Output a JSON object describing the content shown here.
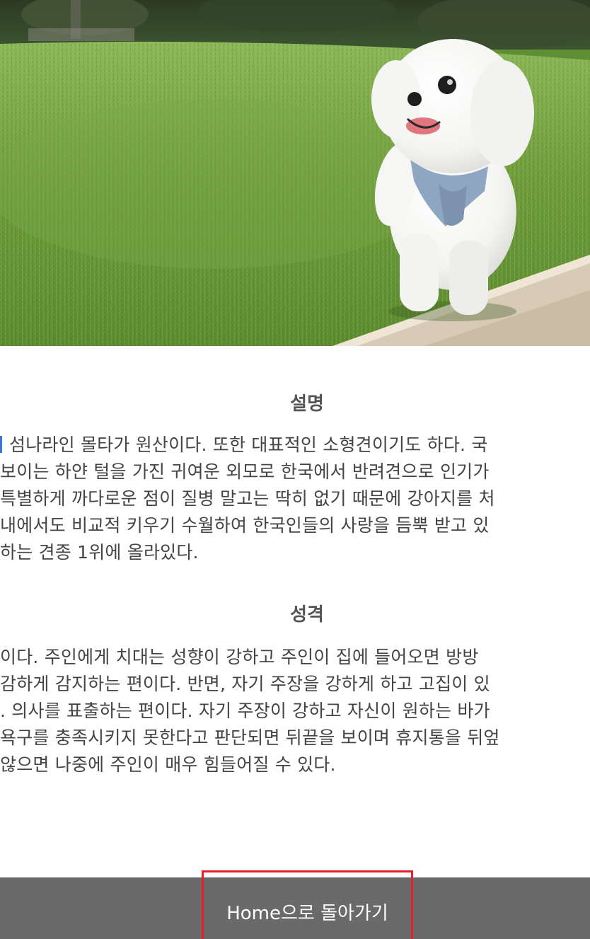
{
  "hero": {
    "image_alt": "흰색 몰티즈 강아지가 잔디밭 연석 위에 서 있는 사진",
    "icon": "photo"
  },
  "description": {
    "title": "설명",
    "lines": [
      "섬나라인 몰타가 원산이다. 또한 대표적인 소형견이기도 하다. 국",
      "보이는 하얀 털을 가진 귀여운 외모로 한국에서 반려견으로 인기가",
      "특별하게 까다로운 점이 질병 말고는 딱히 없기 때문에 강아지를 처",
      "내에서도 비교적 키우기 수월하여 한국인들의 사랑을 듬뿍 받고 있",
      "하는 견종 1위에 올라있다."
    ]
  },
  "personality": {
    "title": "성격",
    "lines": [
      "이다. 주인에게 치대는 성향이 강하고 주인이 집에 들어오면 방방",
      "감하게 감지하는 편이다. 반면, 자기 주장을 강하게 하고 고집이 있",
      ". 의사를 표출하는 편이다. 자기 주장이 강하고 자신이 원하는 바가",
      "욕구를 충족시키지 못한다고 판단되면 뒤끝을 보이며 휴지통을 뒤엎",
      "않으면 나중에 주인이 매우 힘들어질 수 있다."
    ]
  },
  "footer": {
    "home_button_label": "Home으로 돌아가기"
  },
  "colors": {
    "footer_bar": "#6a6a6a",
    "button_border": "#e5202a",
    "title_text": "#555555",
    "body_text": "#444444"
  }
}
